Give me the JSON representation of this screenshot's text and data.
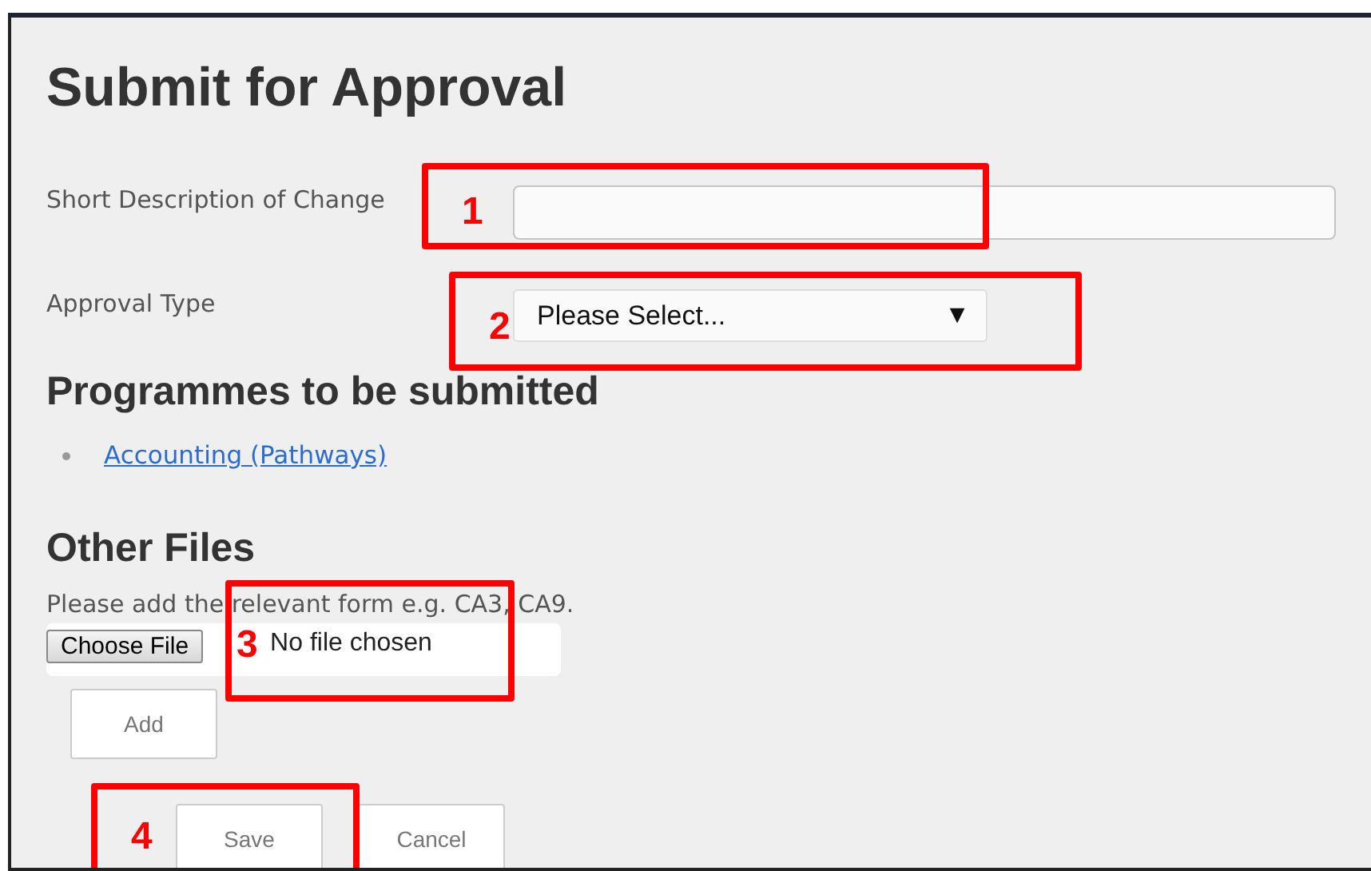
{
  "title": "Submit for Approval",
  "fields": [
    {
      "kind": "text",
      "label": "Short Description of Change"
    },
    {
      "kind": "select",
      "label": "Approval Type",
      "value": "Please Select...",
      "arrow": "▼"
    }
  ],
  "programmes": {
    "heading": "Programmes to be submitted",
    "items": [
      "Accounting (Pathways)"
    ]
  },
  "other_files": {
    "heading": "Other Files",
    "hint": "Please add the relevant form e.g. CA3, CA9.",
    "file_button": "Choose File",
    "file_status": "No file chosen",
    "add_button": "Add"
  },
  "actions": [
    "Save",
    "Cancel"
  ],
  "callouts": [
    "1",
    "2",
    "3",
    "4"
  ]
}
